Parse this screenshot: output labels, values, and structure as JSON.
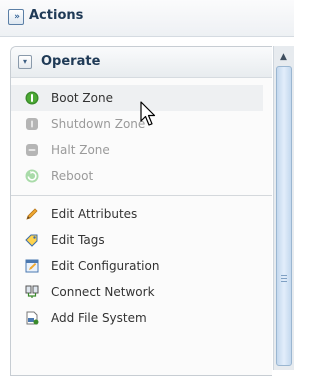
{
  "topbar": {
    "title": "Actions",
    "expand_glyph": "»"
  },
  "panel": {
    "title": "Operate",
    "collapse_glyph": "▾",
    "groups": [
      [
        {
          "label": "Boot Zone",
          "icon": "boot-icon",
          "color": "#3a8a2a",
          "disabled": false,
          "hover": true
        },
        {
          "label": "Shutdown Zone",
          "icon": "shutdown-icon",
          "color": "#a8a8a8",
          "disabled": true
        },
        {
          "label": "Halt Zone",
          "icon": "halt-icon",
          "color": "#a8a8a8",
          "disabled": true
        },
        {
          "label": "Reboot",
          "icon": "reboot-icon",
          "color": "#9fd69f",
          "disabled": true
        }
      ],
      [
        {
          "label": "Edit Attributes",
          "icon": "pencil-icon",
          "disabled": false
        },
        {
          "label": "Edit Tags",
          "icon": "tag-icon",
          "disabled": false
        },
        {
          "label": "Edit Configuration",
          "icon": "edit-config-icon",
          "disabled": false
        },
        {
          "label": "Connect Network",
          "icon": "network-icon",
          "disabled": false
        },
        {
          "label": "Add File System",
          "icon": "file-system-icon",
          "disabled": false
        }
      ]
    ]
  },
  "scrollbar": {
    "up_glyph": "▲"
  }
}
